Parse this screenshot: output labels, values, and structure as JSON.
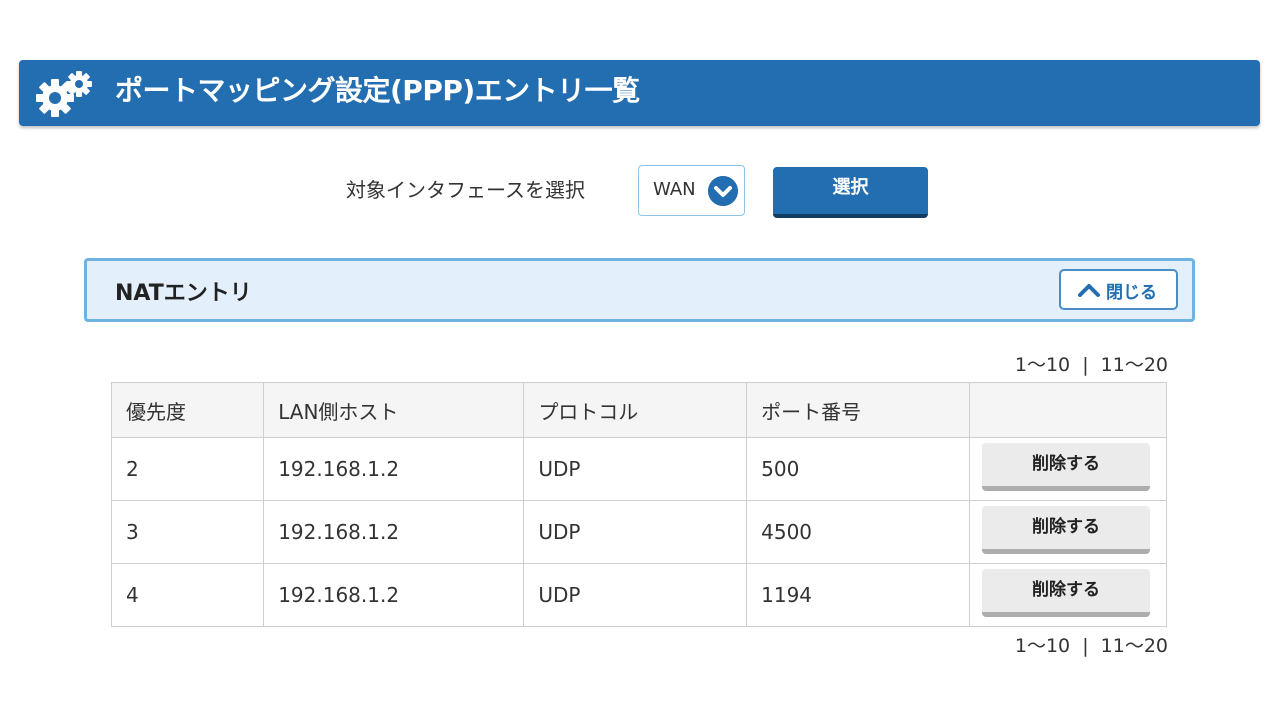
{
  "header": {
    "title": "ポートマッピング設定(PPP)エントリ一覧",
    "icon": "gears-icon",
    "color": "#236eb0"
  },
  "interface": {
    "label": "対象インタフェースを選択",
    "selected": "WAN",
    "select_button": "選択"
  },
  "nat": {
    "title": "NATエントリ",
    "close_label": "閉じる",
    "pager": {
      "range1": "1〜10",
      "separator": "|",
      "range2": "11〜20"
    },
    "columns": [
      "優先度",
      "LAN側ホスト",
      "プロトコル",
      "ポート番号",
      ""
    ],
    "rows": [
      {
        "priority": "2",
        "host": "192.168.1.2",
        "protocol": "UDP",
        "port": "500",
        "action": "削除する"
      },
      {
        "priority": "3",
        "host": "192.168.1.2",
        "protocol": "UDP",
        "port": "4500",
        "action": "削除する"
      },
      {
        "priority": "4",
        "host": "192.168.1.2",
        "protocol": "UDP",
        "port": "1194",
        "action": "削除する"
      }
    ]
  }
}
